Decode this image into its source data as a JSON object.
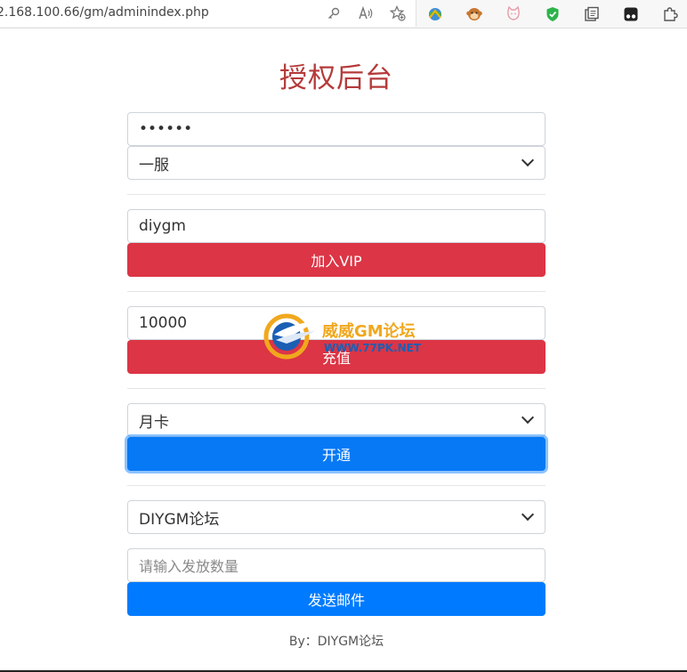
{
  "browser": {
    "url": "2.168.100.66/gm/adminindex.php",
    "addr_icons": [
      "key-icon",
      "read-aloud-icon",
      "favorite-add-icon"
    ],
    "extensions": [
      "ext-globe-icon",
      "ext-monkey-icon",
      "ext-cat-icon",
      "ext-shield-icon",
      "ext-collections-icon",
      "ext-tampermonkey-icon",
      "ext-puzzle-icon"
    ]
  },
  "page": {
    "title": "授权后台",
    "password_value": "••••••",
    "server_select": "一服",
    "vip_input_value": "diygm",
    "vip_button": "加入VIP",
    "recharge_input_value": "10000",
    "recharge_button": "充值",
    "card_select": "月卡",
    "card_button": "开通",
    "mail_select": "DIYGM论坛",
    "mail_quantity_placeholder": "请输入发放数量",
    "mail_button": "发送邮件",
    "footer": "By：DIYGM论坛"
  },
  "watermark": {
    "title": "威威GM论坛",
    "subtitle": "WWW.77PK.NET"
  },
  "colors": {
    "title": "#b53a3a",
    "danger": "#dc3545",
    "primary": "#007bff"
  }
}
